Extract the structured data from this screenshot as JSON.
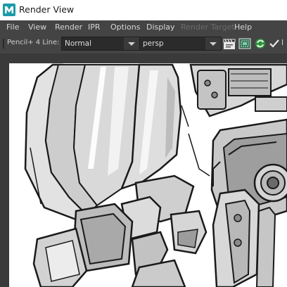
{
  "window": {
    "title": "Render View",
    "app_icon": "maya-logo-icon"
  },
  "menu": {
    "items": [
      {
        "label": "File",
        "enabled": true
      },
      {
        "label": "View",
        "enabled": true
      },
      {
        "label": "Render",
        "enabled": true
      },
      {
        "label": "IPR",
        "enabled": true
      },
      {
        "label": "Options",
        "enabled": true
      },
      {
        "label": "Display",
        "enabled": true
      },
      {
        "label": "Render Target",
        "enabled": false
      },
      {
        "label": "Help",
        "enabled": true
      }
    ]
  },
  "toolbar": {
    "renderer_label": "Pencil+ 4 Line:",
    "line_mode_value": "Normal",
    "camera_value": "persp",
    "icons": [
      "clapperboard-icon",
      "render-region-icon",
      "refresh-icon",
      "checkmark-icon"
    ],
    "trailing_text": "I"
  },
  "viewport": {
    "content": "rendered-image"
  },
  "colors": {
    "window_bg": "#444444",
    "menu_text": "#d6d6d6",
    "disabled_text": "#6b6b6b",
    "field_bg": "#2b2b2b",
    "render_bg": "#ffffff"
  }
}
